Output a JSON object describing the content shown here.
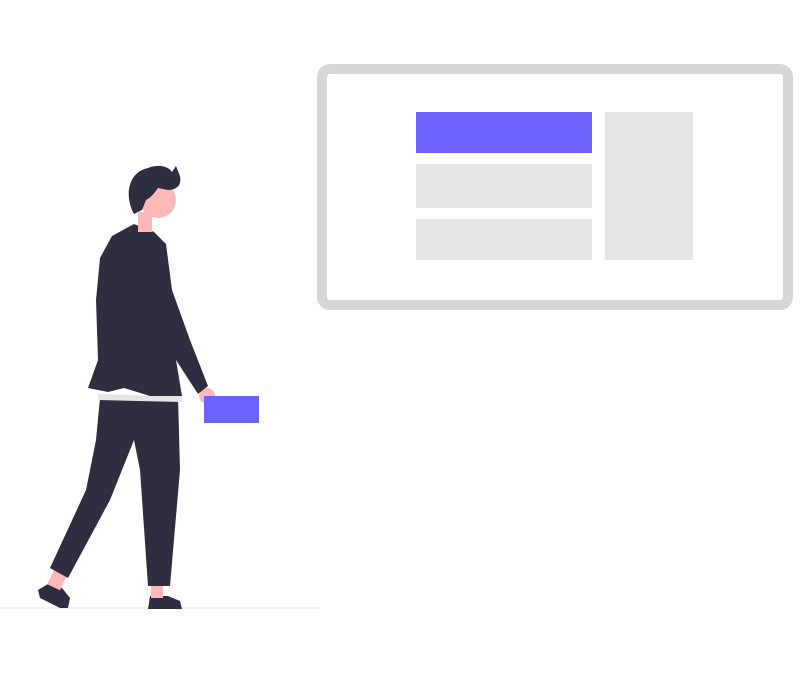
{
  "illustration": {
    "colors": {
      "background": "#ffffff",
      "accent": "#6c63ff",
      "dark": "#2f2e41",
      "skin": "#ffb8b8",
      "frame": "#d6d6d6",
      "placeholder": "#e6e6e6",
      "ground": "#f2f2f2",
      "belt": "#e6e6e6"
    },
    "elements": {
      "frame": "display-frame",
      "accent_bar": "accent-block",
      "placeholder_bars": 2,
      "side_panel": "sidebar-panel",
      "person": "standing-person",
      "held_card": "accent-card"
    }
  }
}
